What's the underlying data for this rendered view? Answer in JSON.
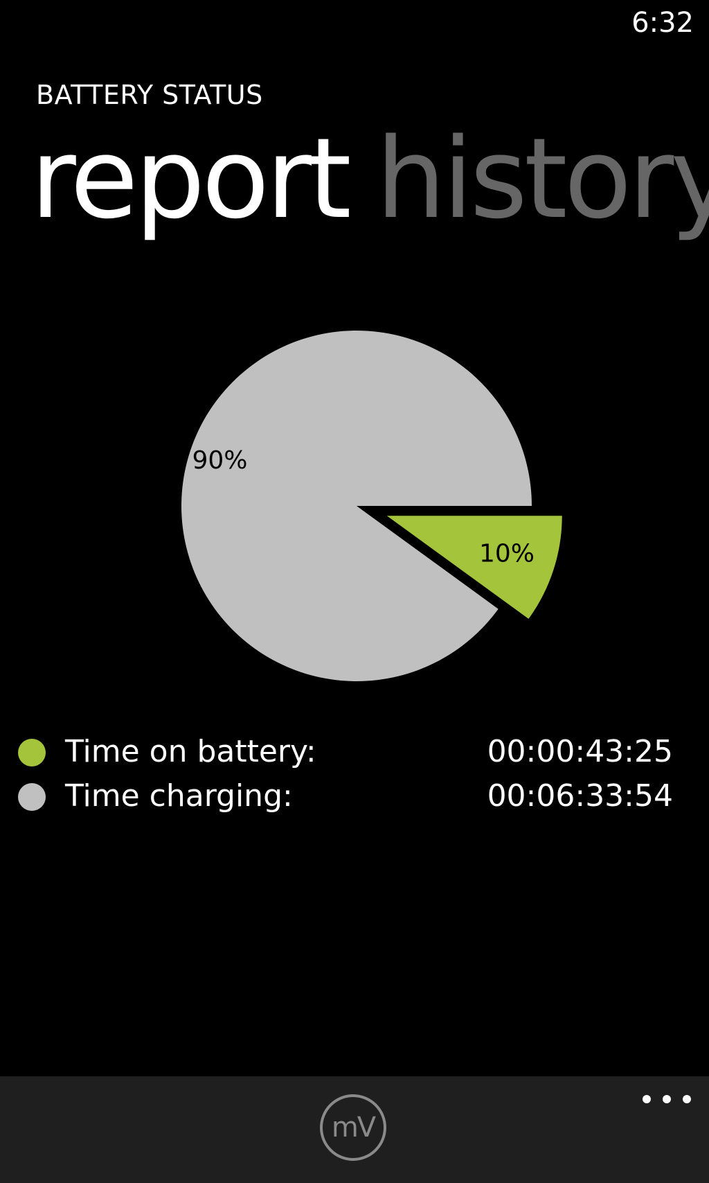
{
  "status_bar": {
    "time": "6:32"
  },
  "app": {
    "title": "BATTERY STATUS"
  },
  "pivot": {
    "tabs": [
      {
        "label": "report",
        "active": true
      },
      {
        "label": "history",
        "active": false
      }
    ]
  },
  "chart_data": {
    "type": "pie",
    "title": "",
    "slices": [
      {
        "label": "Time charging",
        "value": 90,
        "value_label": "90%",
        "color": "#c0c0c0",
        "exploded": false
      },
      {
        "label": "Time on battery",
        "value": 10,
        "value_label": "10%",
        "color": "#a4c43c",
        "exploded": true
      }
    ]
  },
  "legend": {
    "items": [
      {
        "label": "Time on battery:",
        "value": "00:00:43:25",
        "color": "#a4c43c"
      },
      {
        "label": "Time charging:",
        "value": "00:06:33:54",
        "color": "#c0c0c0"
      }
    ]
  },
  "app_bar": {
    "button_label": "mV",
    "button_icon": "mv-circle-icon",
    "more_icon": "ellipsis-icon"
  }
}
